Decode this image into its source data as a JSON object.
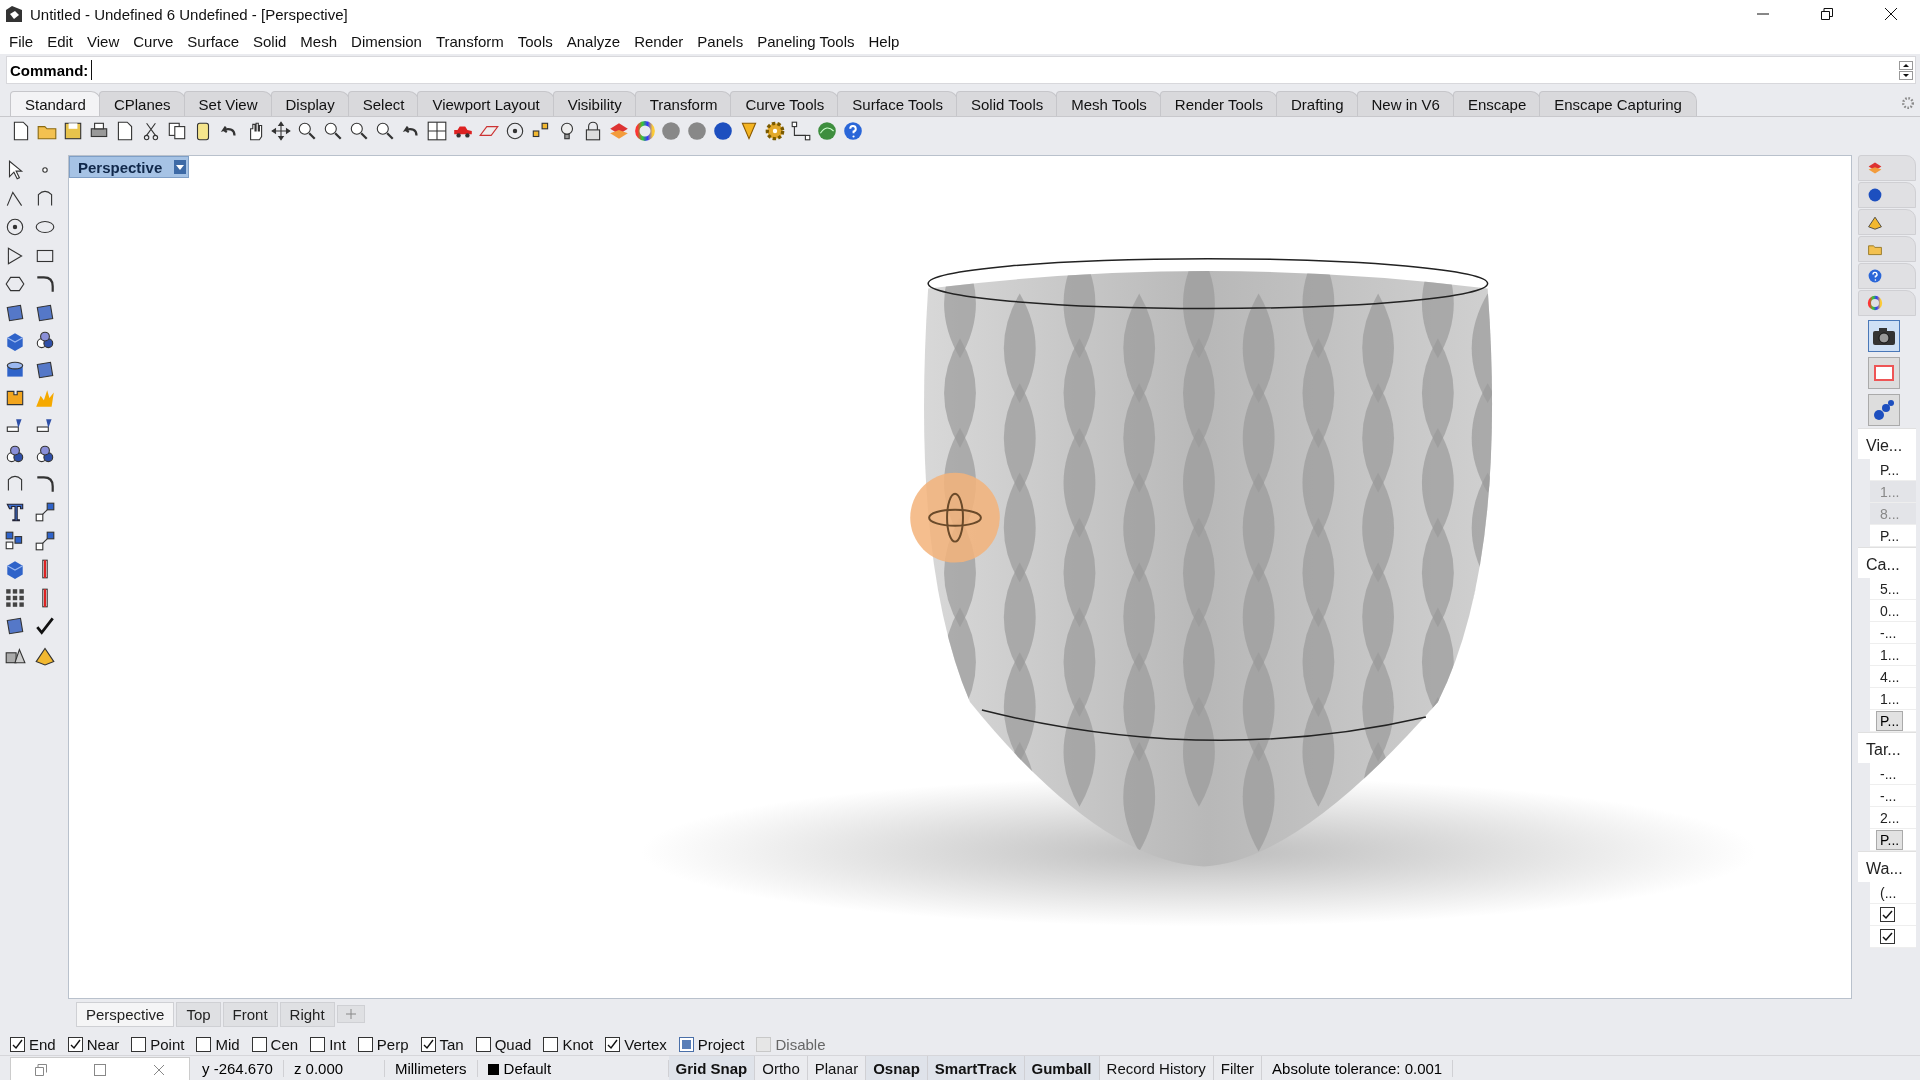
{
  "window": {
    "title": "Untitled - Undefined 6 Undefined - [Perspective]"
  },
  "menu": [
    "File",
    "Edit",
    "View",
    "Curve",
    "Surface",
    "Solid",
    "Mesh",
    "Dimension",
    "Transform",
    "Tools",
    "Analyze",
    "Render",
    "Panels",
    "Paneling Tools",
    "Help"
  ],
  "command": {
    "label": "Command:"
  },
  "toolbar_tabs": [
    {
      "label": "Standard",
      "selected": true
    },
    {
      "label": "CPlanes",
      "selected": false
    },
    {
      "label": "Set View",
      "selected": false
    },
    {
      "label": "Display",
      "selected": false
    },
    {
      "label": "Select",
      "selected": false
    },
    {
      "label": "Viewport Layout",
      "selected": false
    },
    {
      "label": "Visibility",
      "selected": false
    },
    {
      "label": "Transform",
      "selected": false
    },
    {
      "label": "Curve Tools",
      "selected": false
    },
    {
      "label": "Surface Tools",
      "selected": false
    },
    {
      "label": "Solid Tools",
      "selected": false
    },
    {
      "label": "Mesh Tools",
      "selected": false
    },
    {
      "label": "Render Tools",
      "selected": false
    },
    {
      "label": "Drafting",
      "selected": false
    },
    {
      "label": "New in V6",
      "selected": false
    },
    {
      "label": "Enscape",
      "selected": false
    },
    {
      "label": "Enscape Capturing",
      "selected": false
    }
  ],
  "viewport": {
    "title": "Perspective"
  },
  "viewport_tabs": [
    {
      "label": "Perspective",
      "selected": true
    },
    {
      "label": "Top",
      "selected": false
    },
    {
      "label": "Front",
      "selected": false
    },
    {
      "label": "Right",
      "selected": false
    }
  ],
  "right_panel": {
    "sections": [
      {
        "title": "Vie...",
        "rows": [
          {
            "kind": "text",
            "text": "P..."
          },
          {
            "kind": "grey",
            "text": "1..."
          },
          {
            "kind": "grey",
            "text": "8..."
          },
          {
            "kind": "text",
            "text": "P..."
          }
        ]
      },
      {
        "title": "Ca...",
        "rows": [
          {
            "kind": "text",
            "text": "5..."
          },
          {
            "kind": "text",
            "text": "0..."
          },
          {
            "kind": "text",
            "text": "-..."
          },
          {
            "kind": "text",
            "text": "1..."
          },
          {
            "kind": "text",
            "text": "4..."
          },
          {
            "kind": "text",
            "text": "1..."
          },
          {
            "kind": "button",
            "text": "P..."
          }
        ]
      },
      {
        "title": "Tar...",
        "rows": [
          {
            "kind": "text",
            "text": "-..."
          },
          {
            "kind": "text",
            "text": "-..."
          },
          {
            "kind": "text",
            "text": "2..."
          },
          {
            "kind": "button",
            "text": "P..."
          }
        ]
      },
      {
        "title": "Wa...",
        "rows": [
          {
            "kind": "text",
            "text": "(..."
          },
          {
            "kind": "checkbox",
            "checked": true
          },
          {
            "kind": "checkbox",
            "checked": true
          }
        ]
      }
    ]
  },
  "snaps": [
    {
      "label": "End",
      "kind": "tick",
      "checked": true,
      "disabled": false
    },
    {
      "label": "Near",
      "kind": "tick",
      "checked": true,
      "disabled": false
    },
    {
      "label": "Point",
      "kind": "tick",
      "checked": false,
      "disabled": false
    },
    {
      "label": "Mid",
      "kind": "tick",
      "checked": false,
      "disabled": false
    },
    {
      "label": "Cen",
      "kind": "tick",
      "checked": false,
      "disabled": false
    },
    {
      "label": "Int",
      "kind": "tick",
      "checked": false,
      "disabled": false
    },
    {
      "label": "Perp",
      "kind": "tick",
      "checked": false,
      "disabled": false
    },
    {
      "label": "Tan",
      "kind": "tick",
      "checked": true,
      "disabled": false
    },
    {
      "label": "Quad",
      "kind": "tick",
      "checked": false,
      "disabled": false
    },
    {
      "label": "Knot",
      "kind": "tick",
      "checked": false,
      "disabled": false
    },
    {
      "label": "Vertex",
      "kind": "tick",
      "checked": true,
      "disabled": false
    },
    {
      "label": "Project",
      "kind": "fill",
      "checked": true,
      "disabled": false
    },
    {
      "label": "Disable",
      "kind": "tick",
      "checked": false,
      "disabled": true
    }
  ],
  "status_bar": {
    "coords": [
      "y -264.670",
      "z 0.000"
    ],
    "units": "Millimeters",
    "layer": {
      "name": "Default",
      "color": "#000000"
    },
    "toggles": [
      {
        "label": "Grid Snap",
        "on": true
      },
      {
        "label": "Ortho",
        "on": false
      },
      {
        "label": "Planar",
        "on": false
      },
      {
        "label": "Osnap",
        "on": true
      },
      {
        "label": "SmartTrack",
        "on": true
      },
      {
        "label": "Gumball",
        "on": true
      },
      {
        "label": "Record History",
        "on": false
      },
      {
        "label": "Filter",
        "on": false
      }
    ],
    "tolerance": "Absolute tolerance: 0.001"
  }
}
